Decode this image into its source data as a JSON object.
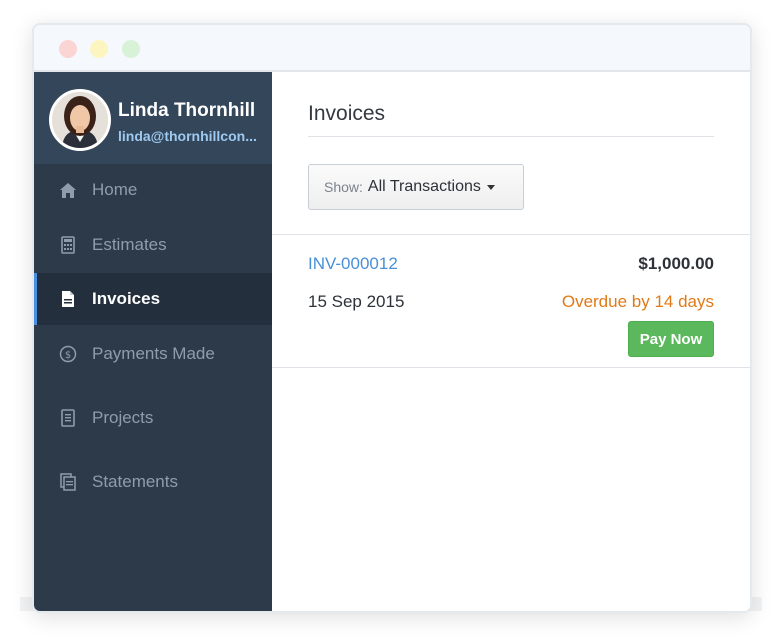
{
  "window": {
    "controls": [
      "close",
      "minimize",
      "maximize"
    ]
  },
  "profile": {
    "name": "Linda Thornhill",
    "email": "linda@thornhillcon..."
  },
  "sidebar": {
    "items": [
      {
        "label": "Home",
        "icon": "home-icon"
      },
      {
        "label": "Estimates",
        "icon": "calculator-icon"
      },
      {
        "label": "Invoices",
        "icon": "document-icon",
        "active": true
      },
      {
        "label": "Payments Made",
        "icon": "dollar-circle-icon"
      },
      {
        "label": "Projects",
        "icon": "clipboard-icon"
      },
      {
        "label": "Statements",
        "icon": "statement-icon"
      }
    ]
  },
  "main": {
    "title": "Invoices",
    "filter": {
      "prefix": "Show:",
      "value": "All Transactions"
    },
    "invoice": {
      "number": "INV-000012",
      "amount": "$1,000.00",
      "date": "15 Sep 2015",
      "status": "Overdue by 14 days",
      "action": "Pay Now"
    }
  },
  "colors": {
    "sidebar_bg": "#2c3a4a",
    "active_item_bg": "#232f3c",
    "link": "#4a90d9",
    "overdue": "#e07a18",
    "pay_button": "#5cb85c"
  }
}
